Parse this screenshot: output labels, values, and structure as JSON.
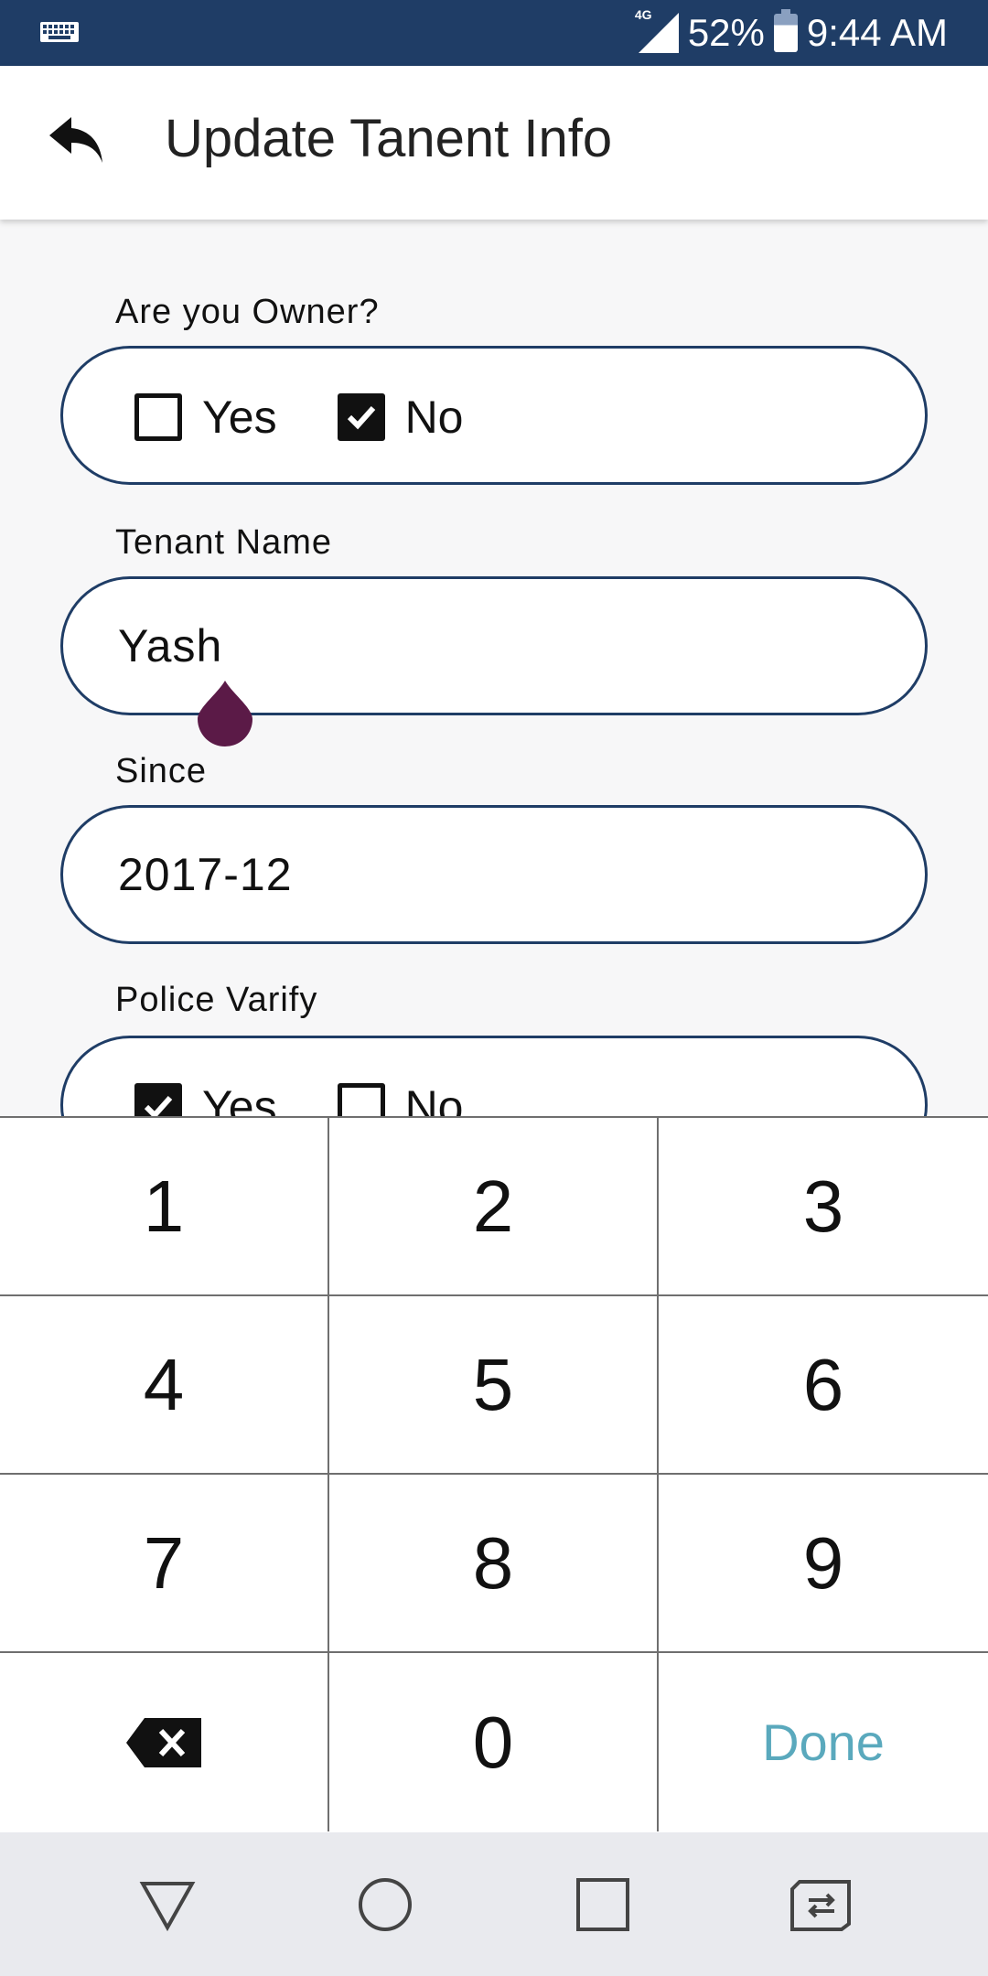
{
  "status_bar": {
    "network": "4G",
    "battery": "52%",
    "time": "9:44 AM",
    "icons": [
      "keyboard-icon",
      "signal-icon",
      "battery-icon"
    ]
  },
  "app_bar": {
    "title": "Update Tanent Info",
    "back_icon": "back-arrow-icon"
  },
  "form": {
    "owner": {
      "label": "Are you Owner?",
      "options": [
        {
          "label": "Yes",
          "checked": false
        },
        {
          "label": "No",
          "checked": true
        }
      ]
    },
    "tenant_name": {
      "label": "Tenant Name",
      "value": "Yash"
    },
    "since": {
      "label": "Since",
      "value": "2017-12"
    },
    "police_verify": {
      "label": "Police Varify",
      "options": [
        {
          "label": "Yes",
          "checked": true
        },
        {
          "label": "No",
          "checked": false
        }
      ]
    }
  },
  "keypad": {
    "keys": [
      "1",
      "2",
      "3",
      "4",
      "5",
      "6",
      "7",
      "8",
      "9",
      "0"
    ],
    "done_label": "Done",
    "backspace_icon": "backspace-icon"
  },
  "nav_bar": {
    "icons": [
      "back-triangle-icon",
      "home-circle-icon",
      "recents-square-icon",
      "switch-apps-icon"
    ]
  },
  "colors": {
    "status_bar": "#1f3d66",
    "field_border": "#1f3d66",
    "cursor_handle": "#5b1a47",
    "done": "#5aa9bd"
  }
}
